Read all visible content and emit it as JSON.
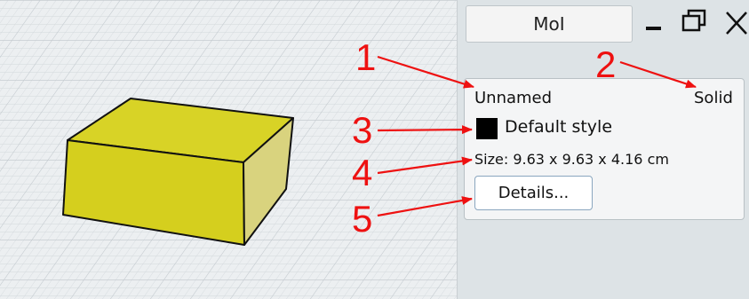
{
  "window": {
    "title": "MoI",
    "minimize_icon": "minimize-icon",
    "restore_icon": "restore-icon",
    "close_icon": "close-icon"
  },
  "properties": {
    "name": "Unnamed",
    "object_type": "Solid",
    "style_label": "Default style",
    "style_color": "#000000",
    "size_text": "Size: 9.63 x 9.63 x 4.16 cm",
    "details_label": "Details..."
  },
  "viewport": {
    "object": "box",
    "object_color": "#d8d326"
  },
  "annotations": {
    "color": "#ee1111",
    "markers": [
      "1",
      "2",
      "3",
      "4",
      "5"
    ]
  }
}
